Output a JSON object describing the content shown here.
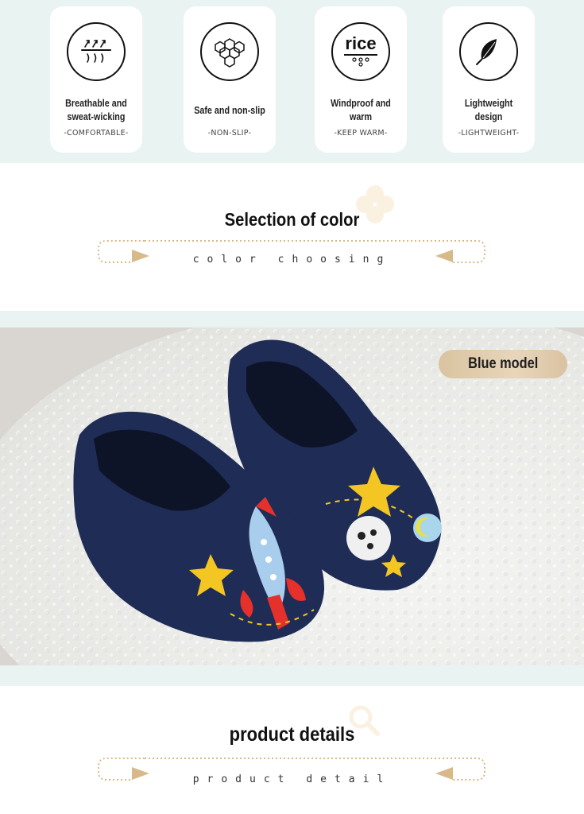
{
  "features": [
    {
      "icon": "breathable-arrows-icon",
      "title": "Breathable and sweat-wicking",
      "subtitle": "-COMFORTABLE-"
    },
    {
      "icon": "honeycomb-icon",
      "title": "Safe and non-slip",
      "subtitle": "-NON-SLIP-"
    },
    {
      "icon": "rice-icon",
      "icon_text": "rice",
      "title": "Windproof and warm",
      "subtitle": "-KEEP WARM-"
    },
    {
      "icon": "feather-icon",
      "title": "Lightweight design",
      "subtitle": "-LIGHTWEIGHT-"
    }
  ],
  "color_section": {
    "title": "Selection of color",
    "subtitle": "color choosing"
  },
  "product_image": {
    "badge": "Blue model"
  },
  "details_section": {
    "title": "product details",
    "subtitle": "product detail"
  },
  "colors": {
    "band": "#e9f3f2",
    "badge": "#dcc6a3",
    "arrow": "#d8b98a",
    "slipper": "#1f2c55"
  }
}
